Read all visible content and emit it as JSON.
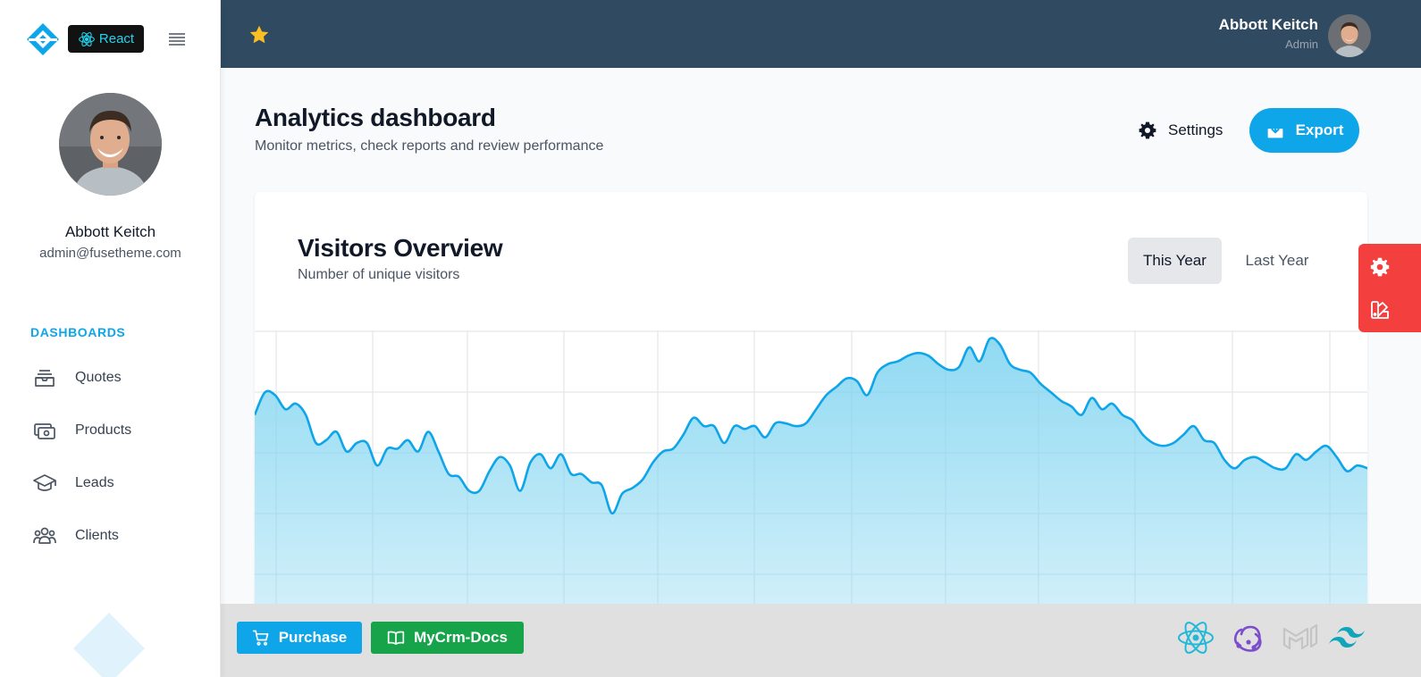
{
  "brand": {
    "badge_label": "React"
  },
  "sidebar": {
    "user": {
      "name": "Abbott Keitch",
      "email": "admin@fusetheme.com"
    },
    "section_title": "DASHBOARDS",
    "items": [
      {
        "label": "Quotes",
        "icon": "inbox-stack-icon"
      },
      {
        "label": "Products",
        "icon": "cash-icon"
      },
      {
        "label": "Leads",
        "icon": "academic-cap-icon"
      },
      {
        "label": "Clients",
        "icon": "user-group-icon"
      }
    ]
  },
  "topbar": {
    "user_name": "Abbott Keitch",
    "user_role": "Admin"
  },
  "page": {
    "title": "Analytics dashboard",
    "subtitle": "Monitor metrics, check reports and review performance",
    "settings_label": "Settings",
    "export_label": "Export"
  },
  "visitors": {
    "title": "Visitors Overview",
    "subtitle": "Number of unique visitors",
    "tabs": [
      {
        "label": "This Year",
        "active": true
      },
      {
        "label": "Last Year",
        "active": false
      }
    ]
  },
  "chart_data": {
    "type": "area",
    "title": "Visitors Overview",
    "subtitle": "Number of unique visitors",
    "xlabel": "",
    "ylabel": "",
    "ylim": [
      0,
      100
    ],
    "grid": true,
    "color": "#0ea5e9",
    "y": [
      70,
      78,
      77,
      72,
      74,
      70,
      60,
      61,
      64,
      57,
      60,
      60,
      52,
      58,
      58,
      61,
      57,
      64,
      57,
      49,
      48,
      43,
      43,
      50,
      55,
      52,
      43,
      53,
      56,
      51,
      56,
      49,
      49,
      46,
      45,
      35,
      42,
      44,
      47,
      53,
      57,
      58,
      63,
      69,
      66,
      66,
      60,
      66,
      65,
      66,
      62,
      67,
      67,
      66,
      67,
      72,
      77,
      80,
      83,
      82,
      77,
      85,
      88,
      89,
      91,
      92,
      91,
      88,
      86,
      87,
      94,
      89,
      97,
      95,
      88,
      86,
      85,
      81,
      78,
      75,
      73,
      70,
      76,
      72,
      74,
      70,
      68,
      63,
      60,
      59,
      60,
      63,
      66,
      61,
      60,
      54,
      51,
      54,
      55,
      53,
      51,
      51,
      56,
      54,
      57,
      59,
      55,
      50,
      52,
      51
    ]
  },
  "side_panel": {
    "icons": [
      "gear-icon",
      "palette-icon"
    ]
  },
  "footer": {
    "purchase_label": "Purchase",
    "docs_label": "MyCrm-Docs",
    "tech_logos": [
      "react-logo",
      "redux-logo",
      "material-ui-logo",
      "tailwind-logo"
    ]
  },
  "colors": {
    "primary": "#0ea5e9",
    "topbar": "#2f4a61",
    "success": "#16a34a",
    "danger": "#f43f3f"
  }
}
